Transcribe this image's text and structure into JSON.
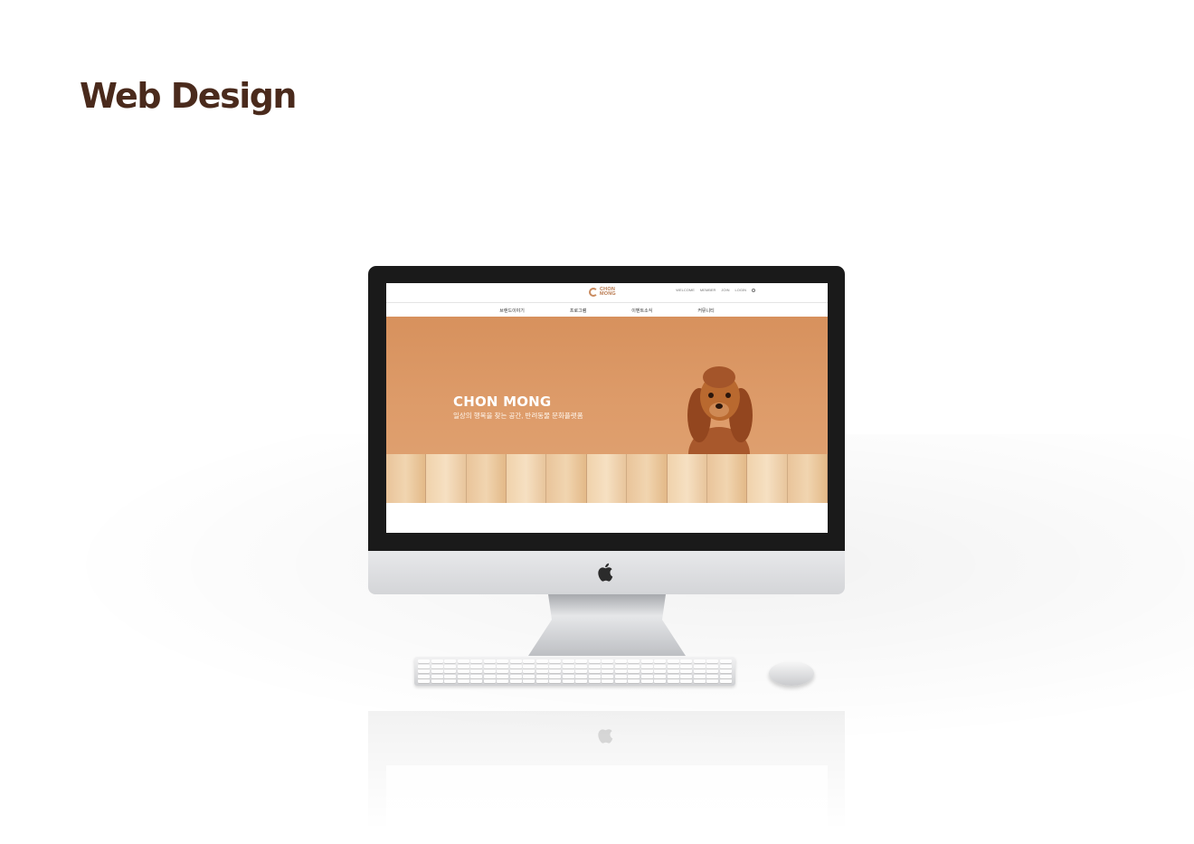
{
  "page": {
    "heading": "Web Design"
  },
  "website": {
    "logo": {
      "line1": "CHON",
      "line2": "MONG"
    },
    "util_links": [
      "WELCOME",
      "MEMBER",
      "JOIN",
      "LOGIN"
    ],
    "nav": [
      "브랜드이야기",
      "프로그램",
      "이벤트소식",
      "커뮤니티"
    ],
    "hero": {
      "title": "CHON MONG",
      "subtitle": "일상의 행복을 찾는 공간, 반려동물 문화플랫폼"
    }
  },
  "colors": {
    "heading": "#4a2a1c",
    "hero_bg": "#dd9b69",
    "brand": "#b8774c",
    "bezel": "#1a1a1a"
  }
}
